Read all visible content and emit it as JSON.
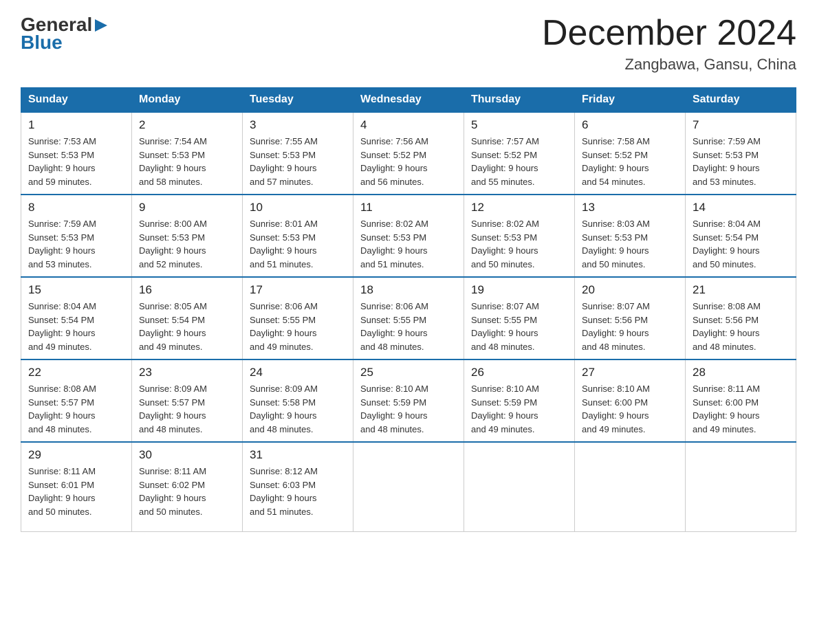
{
  "logo": {
    "general": "General",
    "blue": "Blue",
    "arrow": "▶"
  },
  "header": {
    "month_year": "December 2024",
    "location": "Zangbawa, Gansu, China"
  },
  "days_of_week": [
    "Sunday",
    "Monday",
    "Tuesday",
    "Wednesday",
    "Thursday",
    "Friday",
    "Saturday"
  ],
  "weeks": [
    [
      {
        "day": "1",
        "sunrise": "7:53 AM",
        "sunset": "5:53 PM",
        "daylight": "9 hours and 59 minutes."
      },
      {
        "day": "2",
        "sunrise": "7:54 AM",
        "sunset": "5:53 PM",
        "daylight": "9 hours and 58 minutes."
      },
      {
        "day": "3",
        "sunrise": "7:55 AM",
        "sunset": "5:53 PM",
        "daylight": "9 hours and 57 minutes."
      },
      {
        "day": "4",
        "sunrise": "7:56 AM",
        "sunset": "5:52 PM",
        "daylight": "9 hours and 56 minutes."
      },
      {
        "day": "5",
        "sunrise": "7:57 AM",
        "sunset": "5:52 PM",
        "daylight": "9 hours and 55 minutes."
      },
      {
        "day": "6",
        "sunrise": "7:58 AM",
        "sunset": "5:52 PM",
        "daylight": "9 hours and 54 minutes."
      },
      {
        "day": "7",
        "sunrise": "7:59 AM",
        "sunset": "5:53 PM",
        "daylight": "9 hours and 53 minutes."
      }
    ],
    [
      {
        "day": "8",
        "sunrise": "7:59 AM",
        "sunset": "5:53 PM",
        "daylight": "9 hours and 53 minutes."
      },
      {
        "day": "9",
        "sunrise": "8:00 AM",
        "sunset": "5:53 PM",
        "daylight": "9 hours and 52 minutes."
      },
      {
        "day": "10",
        "sunrise": "8:01 AM",
        "sunset": "5:53 PM",
        "daylight": "9 hours and 51 minutes."
      },
      {
        "day": "11",
        "sunrise": "8:02 AM",
        "sunset": "5:53 PM",
        "daylight": "9 hours and 51 minutes."
      },
      {
        "day": "12",
        "sunrise": "8:02 AM",
        "sunset": "5:53 PM",
        "daylight": "9 hours and 50 minutes."
      },
      {
        "day": "13",
        "sunrise": "8:03 AM",
        "sunset": "5:53 PM",
        "daylight": "9 hours and 50 minutes."
      },
      {
        "day": "14",
        "sunrise": "8:04 AM",
        "sunset": "5:54 PM",
        "daylight": "9 hours and 50 minutes."
      }
    ],
    [
      {
        "day": "15",
        "sunrise": "8:04 AM",
        "sunset": "5:54 PM",
        "daylight": "9 hours and 49 minutes."
      },
      {
        "day": "16",
        "sunrise": "8:05 AM",
        "sunset": "5:54 PM",
        "daylight": "9 hours and 49 minutes."
      },
      {
        "day": "17",
        "sunrise": "8:06 AM",
        "sunset": "5:55 PM",
        "daylight": "9 hours and 49 minutes."
      },
      {
        "day": "18",
        "sunrise": "8:06 AM",
        "sunset": "5:55 PM",
        "daylight": "9 hours and 48 minutes."
      },
      {
        "day": "19",
        "sunrise": "8:07 AM",
        "sunset": "5:55 PM",
        "daylight": "9 hours and 48 minutes."
      },
      {
        "day": "20",
        "sunrise": "8:07 AM",
        "sunset": "5:56 PM",
        "daylight": "9 hours and 48 minutes."
      },
      {
        "day": "21",
        "sunrise": "8:08 AM",
        "sunset": "5:56 PM",
        "daylight": "9 hours and 48 minutes."
      }
    ],
    [
      {
        "day": "22",
        "sunrise": "8:08 AM",
        "sunset": "5:57 PM",
        "daylight": "9 hours and 48 minutes."
      },
      {
        "day": "23",
        "sunrise": "8:09 AM",
        "sunset": "5:57 PM",
        "daylight": "9 hours and 48 minutes."
      },
      {
        "day": "24",
        "sunrise": "8:09 AM",
        "sunset": "5:58 PM",
        "daylight": "9 hours and 48 minutes."
      },
      {
        "day": "25",
        "sunrise": "8:10 AM",
        "sunset": "5:59 PM",
        "daylight": "9 hours and 48 minutes."
      },
      {
        "day": "26",
        "sunrise": "8:10 AM",
        "sunset": "5:59 PM",
        "daylight": "9 hours and 49 minutes."
      },
      {
        "day": "27",
        "sunrise": "8:10 AM",
        "sunset": "6:00 PM",
        "daylight": "9 hours and 49 minutes."
      },
      {
        "day": "28",
        "sunrise": "8:11 AM",
        "sunset": "6:00 PM",
        "daylight": "9 hours and 49 minutes."
      }
    ],
    [
      {
        "day": "29",
        "sunrise": "8:11 AM",
        "sunset": "6:01 PM",
        "daylight": "9 hours and 50 minutes."
      },
      {
        "day": "30",
        "sunrise": "8:11 AM",
        "sunset": "6:02 PM",
        "daylight": "9 hours and 50 minutes."
      },
      {
        "day": "31",
        "sunrise": "8:12 AM",
        "sunset": "6:03 PM",
        "daylight": "9 hours and 51 minutes."
      },
      null,
      null,
      null,
      null
    ]
  ]
}
